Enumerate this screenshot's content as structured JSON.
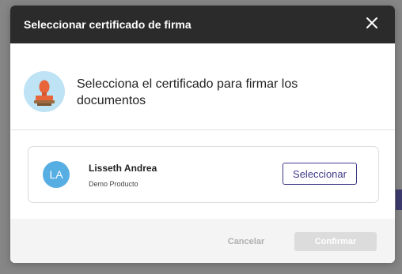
{
  "modal": {
    "title": "Seleccionar certificado de firma",
    "close_icon": "close-icon",
    "intro_icon": "stamp-icon",
    "intro_text": "Selecciona el certificado para firmar los documentos"
  },
  "certificates": [
    {
      "initials": "LA",
      "name": "Lisseth Andrea",
      "organization": "Demo Producto",
      "select_label": "Seleccionar"
    }
  ],
  "footer": {
    "cancel_label": "Cancelar",
    "confirm_label": "Confirmar"
  },
  "colors": {
    "header_bg": "#2b2b2b",
    "accent": "#3f3a86",
    "avatar_bg": "#57aee3",
    "icon_bg": "#bde3f5",
    "disabled": "#dcdcdc"
  }
}
